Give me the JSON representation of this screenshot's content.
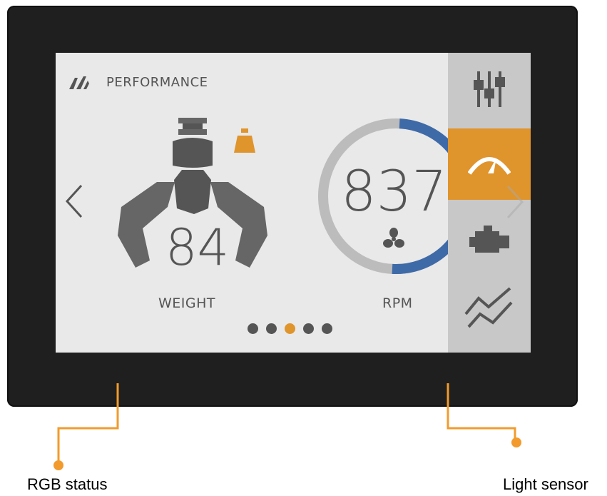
{
  "header": {
    "title": "PERFORMANCE",
    "icon": "speedometer-icon"
  },
  "weight": {
    "value": "84",
    "label": "WEIGHT",
    "icon": "grapple-claw-icon",
    "badge_icon": "weight-icon"
  },
  "rpm": {
    "value": "837",
    "label": "RPM",
    "icon": "fan-icon",
    "gauge_fraction": 0.5
  },
  "sidebar": {
    "items": [
      {
        "name": "settings",
        "icon": "sliders-icon",
        "active": false
      },
      {
        "name": "performance",
        "icon": "speedometer-icon",
        "active": true
      },
      {
        "name": "engine",
        "icon": "engine-icon",
        "active": false
      },
      {
        "name": "trends",
        "icon": "trend-chart-icon",
        "active": false
      }
    ]
  },
  "pager": {
    "count": 5,
    "active_index": 2
  },
  "callouts": {
    "left": "RGB status",
    "right": "Light sensor"
  },
  "colors": {
    "accent": "#e0942c",
    "gauge_blue": "#3f6aa8",
    "bezel": "#1f1f1f",
    "screen": "#e9e9e9",
    "sidebar": "#c8c8c8",
    "text": "#555555"
  }
}
